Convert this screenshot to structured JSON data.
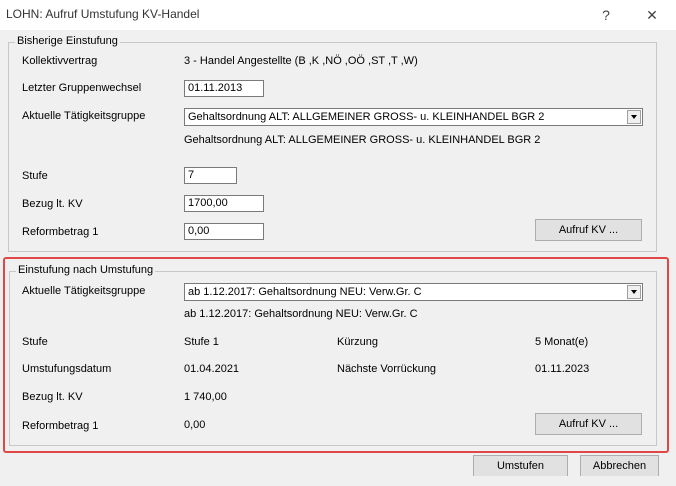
{
  "window": {
    "title": "LOHN: Aufruf Umstufung KV-Handel",
    "help_label": "?",
    "close_label": "✕"
  },
  "bisherige": {
    "legend": "Bisherige Einstufung",
    "kollektivvertrag_label": "Kollektivvertrag",
    "kollektivvertrag_value": "3 - Handel Angestellte (B ,K ,NÖ ,OÖ ,ST ,T ,W)",
    "gruppenwechsel_label": "Letzter Gruppenwechsel",
    "gruppenwechsel_value": "01.11.2013",
    "taetigkeitsgruppe_label": "Aktuelle Tätigkeitsgruppe",
    "taetigkeitsgruppe_select": "Gehaltsordnung ALT: ALLGEMEINER GROSS- u. KLEINHANDEL        BGR 2",
    "taetigkeitsgruppe_text": "Gehaltsordnung ALT: ALLGEMEINER GROSS- u. KLEINHANDEL        BGR 2",
    "stufe_label": "Stufe",
    "stufe_value": "7",
    "bezug_label": "Bezug lt. KV",
    "bezug_value": "1700,00",
    "reformbetrag_label": "Reformbetrag 1",
    "reformbetrag_value": "0,00",
    "aufruf_kv_label": "Aufruf KV ..."
  },
  "nach": {
    "legend": "Einstufung nach Umstufung",
    "taetigkeitsgruppe_label": "Aktuelle Tätigkeitsgruppe",
    "taetigkeitsgruppe_select": "ab 1.12.2017: Gehaltsordnung NEU: Verw.Gr. C",
    "taetigkeitsgruppe_text": "ab 1.12.2017: Gehaltsordnung NEU: Verw.Gr. C",
    "stufe_label": "Stufe",
    "stufe_value": "Stufe 1",
    "kuerzung_label": "Kürzung",
    "kuerzung_value": "5 Monat(e)",
    "umstufungsdatum_label": "Umstufungsdatum",
    "umstufungsdatum_value": "01.04.2021",
    "naechste_label": "Nächste Vorrückung",
    "naechste_value": "01.11.2023",
    "bezug_label": "Bezug lt. KV",
    "bezug_value": "1 740,00",
    "reformbetrag_label": "Reformbetrag 1",
    "reformbetrag_value": "0,00",
    "aufruf_kv_label": "Aufruf KV ..."
  },
  "footer": {
    "umstufen_label": "Umstufen",
    "abbrechen_label": "Abbrechen"
  },
  "colors": {
    "highlight": "#e04848",
    "background": "#f0f0f0"
  }
}
